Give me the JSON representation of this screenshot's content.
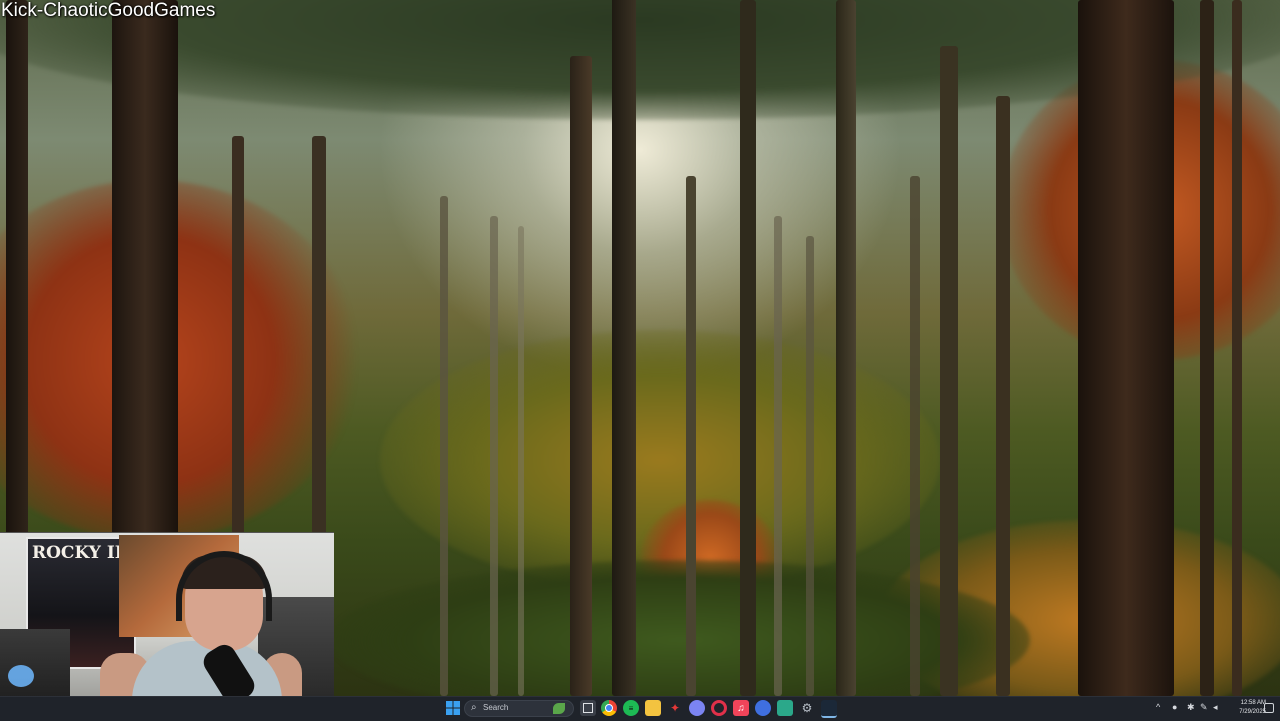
{
  "overlay": {
    "channel_watermark": "Kick-ChaoticGoodGames"
  },
  "webcam": {
    "poster_text": "ROCKY II"
  },
  "taskbar": {
    "search_placeholder": "Search",
    "start_icon": "windows-start-icon",
    "pinned_icons": [
      "search-highlight-leaf-icon",
      "task-view-icon",
      "chrome-icon",
      "spotify-icon",
      "file-explorer-icon",
      "red-app-icon",
      "discord-icon",
      "opera-gx-icon",
      "apple-music-icon",
      "media-app-icon",
      "terminal-icon",
      "settings-gear-icon",
      "steam-icon"
    ],
    "tray": {
      "chevron": "^",
      "time": "12:58 AM",
      "date": "7/29/2025"
    }
  },
  "colors": {
    "taskbar_bg": "#1f232a",
    "watermark_text": "#ffffff"
  }
}
